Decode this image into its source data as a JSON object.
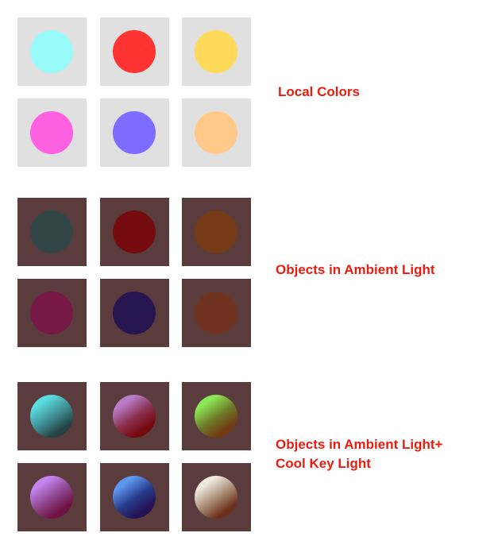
{
  "groups": [
    {
      "id": "local",
      "label_lines": [
        "Local Colors"
      ],
      "tile_color": "#e0e0e0",
      "swatches": [
        {
          "name": "cyan",
          "fill": "#99fafa"
        },
        {
          "name": "red",
          "fill": "#ff3432"
        },
        {
          "name": "yellow",
          "fill": "#ffd95a"
        },
        {
          "name": "pink",
          "fill": "#fd61e2"
        },
        {
          "name": "violet",
          "fill": "#7c6cff"
        },
        {
          "name": "peach",
          "fill": "#ffc98a"
        }
      ]
    },
    {
      "id": "ambient",
      "label_lines": [
        "Objects in Ambient Light"
      ],
      "tile_color": "#5b3c3d",
      "swatches": [
        {
          "name": "cyan",
          "fill": "#324648"
        },
        {
          "name": "red",
          "fill": "#760b0f"
        },
        {
          "name": "yellow",
          "fill": "#753b16"
        },
        {
          "name": "pink",
          "fill": "#761946"
        },
        {
          "name": "violet",
          "fill": "#26154f"
        },
        {
          "name": "peach",
          "fill": "#703320"
        }
      ]
    },
    {
      "id": "keylight",
      "label_lines": [
        "Objects in Ambient Light+",
        "Cool Key Light"
      ],
      "tile_color": "#5b3c3d",
      "swatches": [
        {
          "name": "cyan",
          "fill": "#3e8e93",
          "shade": "#244143",
          "light": "#5cdbe0"
        },
        {
          "name": "red",
          "fill": "#8a3050",
          "shade": "#75090e",
          "light": "#b77ec7"
        },
        {
          "name": "yellow",
          "fill": "#6d7a28",
          "shade": "#713a12",
          "light": "#8de855"
        },
        {
          "name": "pink",
          "fill": "#8c4489",
          "shade": "#6e1143",
          "light": "#c384ee"
        },
        {
          "name": "violet",
          "fill": "#283b8c",
          "shade": "#231255",
          "light": "#5c98ee"
        },
        {
          "name": "peach",
          "fill": "#a88a72",
          "shade": "#6d301c",
          "light": "#efeae0"
        }
      ]
    }
  ]
}
